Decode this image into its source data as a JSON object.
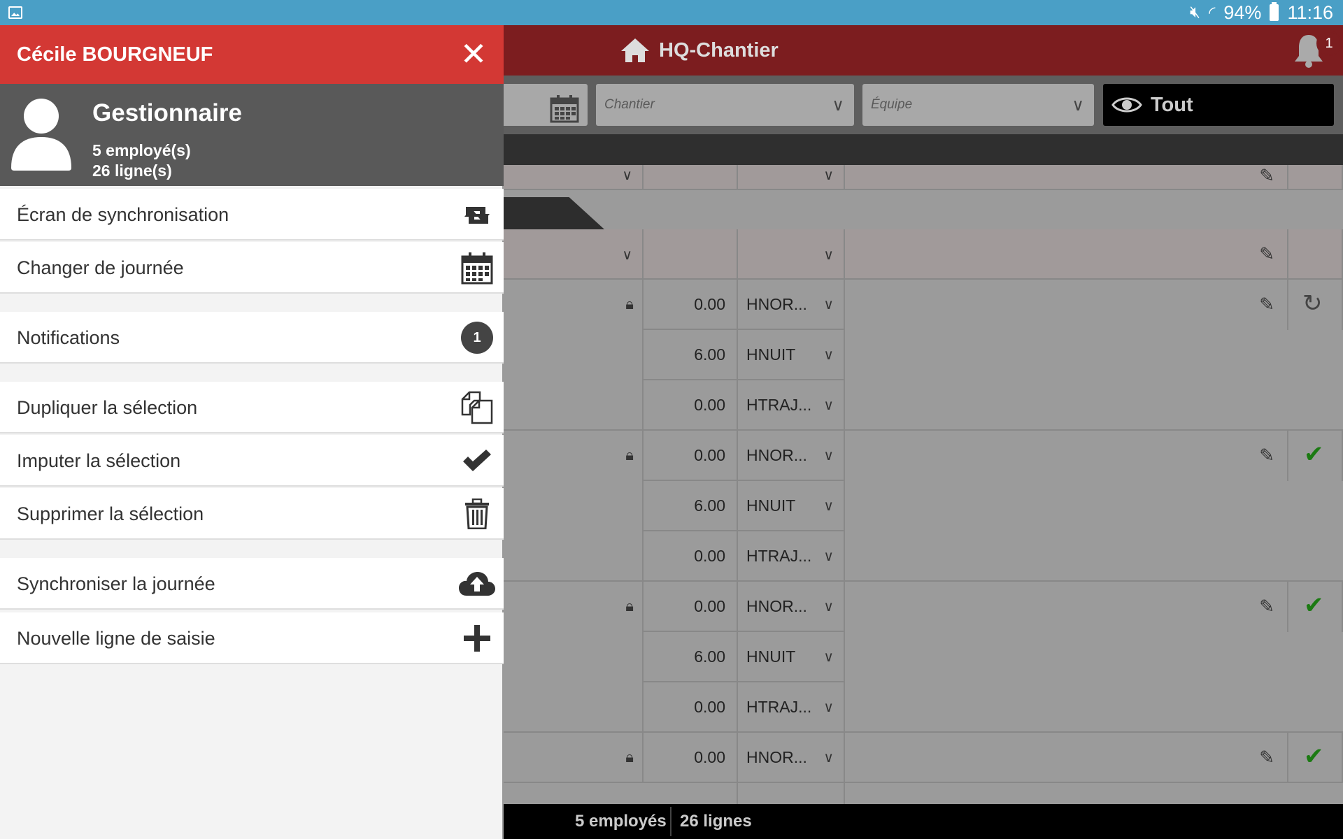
{
  "status_bar": {
    "battery": "94%",
    "time": "11:16"
  },
  "app_bar": {
    "title": "HQ-Chantier",
    "notification_count": "1"
  },
  "filters": {
    "chantier_placeholder": "Chantier",
    "equipe_placeholder": "Équipe",
    "view_label": "Tout"
  },
  "grid": {
    "rows": [
      {
        "value": "0.00",
        "code": "HNOR..."
      },
      {
        "value": "6.00",
        "code": "HNUIT"
      },
      {
        "value": "0.00",
        "code": "HTRAJ..."
      },
      {
        "value": "0.00",
        "code": "HNOR..."
      },
      {
        "value": "6.00",
        "code": "HNUIT"
      },
      {
        "value": "0.00",
        "code": "HTRAJ..."
      },
      {
        "value": "0.00",
        "code": "HNOR..."
      },
      {
        "value": "6.00",
        "code": "HNUIT"
      },
      {
        "value": "0.00",
        "code": "HTRAJ..."
      },
      {
        "value": "0.00",
        "code": "HNOR..."
      }
    ]
  },
  "footer": {
    "employees": "5 employés",
    "lines": "26 lignes"
  },
  "drawer": {
    "user_name": "Cécile BOURGNEUF",
    "close_label": "✕",
    "role": "Gestionnaire",
    "employees": "5 employé(s)",
    "lines": "26 ligne(s)",
    "notifications_badge": "1",
    "menu": {
      "sync_screen": "Écran de synchronisation",
      "change_day": "Changer de journée",
      "notifications": "Notifications",
      "duplicate": "Dupliquer la sélection",
      "impute": "Imputer la sélection",
      "delete": "Supprimer la sélection",
      "sync_day": "Synchroniser la journée",
      "new_line": "Nouvelle ligne de saisie"
    }
  },
  "colors": {
    "drawer_header": "#d33834",
    "app_bar": "#7c1d1f",
    "status_bar": "#4a9fc6",
    "check": "#1b7a12"
  }
}
